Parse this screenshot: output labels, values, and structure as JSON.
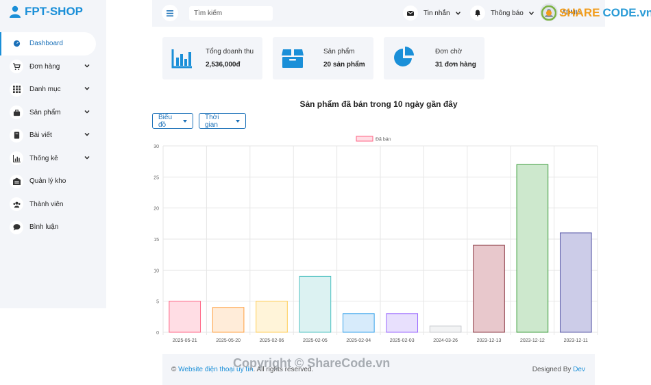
{
  "brand": "FPT-SHOP",
  "sidebar": {
    "items": [
      {
        "label": "Dashboard",
        "icon": "dashboard-icon",
        "active": true
      },
      {
        "label": "Đơn hàng",
        "icon": "cart-icon",
        "chevron": true
      },
      {
        "label": "Danh mục",
        "icon": "grid-icon",
        "chevron": true
      },
      {
        "label": "Sản phẩm",
        "icon": "bag-icon",
        "chevron": true
      },
      {
        "label": "Bài viết",
        "icon": "book-icon",
        "chevron": true
      },
      {
        "label": "Thống kê",
        "icon": "chart-icon",
        "chevron": true
      },
      {
        "label": "Quản lý kho",
        "icon": "warehouse-icon"
      },
      {
        "label": "Thành viên",
        "icon": "users-icon"
      },
      {
        "label": "Bình luận",
        "icon": "comment-icon"
      }
    ]
  },
  "topbar": {
    "search_placeholder": "Tìm kiếm",
    "messages_label": "Tin nhắn",
    "notifications_label": "Thông báo",
    "user_label": "ADMIN"
  },
  "stats": [
    {
      "label": "Tổng doanh thu",
      "value": "2,536,000đ",
      "icon": "bar-chart-icon"
    },
    {
      "label": "Sản phẩm",
      "value": "20 sản phẩm",
      "icon": "box-icon"
    },
    {
      "label": "Đơn chờ",
      "value": "31 đơn hàng",
      "icon": "pie-chart-icon"
    }
  ],
  "chart_title": "Sản phẩm đã bán trong 10 ngày gần đây",
  "dropdowns": {
    "chart_type": "Biểu đồ",
    "time": "Thời gian"
  },
  "chart_data": {
    "type": "bar",
    "categories": [
      "2025-05-21",
      "2025-05-20",
      "2025-02-06",
      "2025-02-05",
      "2025-02-04",
      "2025-02-03",
      "2024-03-26",
      "2023-12-13",
      "2023-12-12",
      "2023-12-11"
    ],
    "series": [
      {
        "name": "Đã bán",
        "values": [
          5,
          4,
          5,
          9,
          3,
          3,
          1,
          14,
          27,
          16
        ]
      }
    ],
    "ylim": [
      0,
      30
    ],
    "yticks": [
      0,
      5,
      10,
      15,
      20,
      25,
      30
    ],
    "legend_position": "top",
    "grid": true,
    "bar_fills": [
      "#ffdde4",
      "#ffecd9",
      "#fff4d9",
      "#dcf2f2",
      "#d7ebfb",
      "#e8e0fd",
      "#f2f3f4",
      "#e8c8cc",
      "#cde8cd",
      "#cccce8"
    ],
    "bar_borders": [
      "#ff6384",
      "#ff9f40",
      "#ffcd56",
      "#4bc0c0",
      "#36a2eb",
      "#9966ff",
      "#c9cbcf",
      "#8b3a44",
      "#3f9e3f",
      "#5a5aa8"
    ]
  },
  "footer": {
    "copyright": "©",
    "link_text": "Website điện thoại uy tín",
    "rights": ". All rights reserved.",
    "designed_by": "Designed By",
    "dev": "Dev"
  },
  "watermark": {
    "logo_prefix": "SHARE",
    "logo_suffix": "CODE.vn",
    "copyright": "Copyright © ShareCode.vn"
  }
}
